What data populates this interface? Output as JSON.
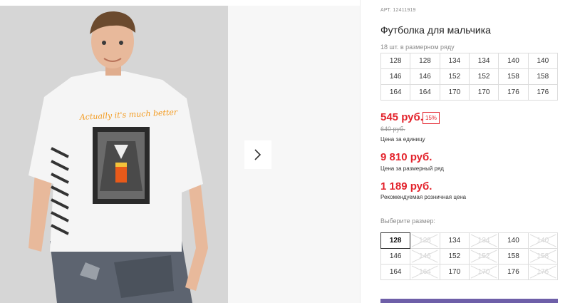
{
  "product": {
    "sku": "АРТ. 12411919",
    "title": "Футболка для мальчика",
    "series_note": "18 шт. в размерном ряду"
  },
  "series_sizes": [
    [
      "128",
      "128",
      "134",
      "134",
      "140",
      "140"
    ],
    [
      "146",
      "146",
      "152",
      "152",
      "158",
      "158"
    ],
    [
      "164",
      "164",
      "170",
      "170",
      "176",
      "176"
    ]
  ],
  "pricing": {
    "unit_price": "545 руб.",
    "discount": "15%",
    "old_price": "640 руб.",
    "unit_caption": "Цена за единицу",
    "series_price": "9 810 руб.",
    "series_caption": "Цена за размерный ряд",
    "retail_price": "1 189 руб.",
    "retail_caption": "Рекомендуемая розничная цена"
  },
  "size_picker": {
    "label": "Выберите размер:",
    "selected": "128",
    "rows": [
      [
        {
          "v": "128",
          "state": "selected"
        },
        {
          "v": "128",
          "state": "unavailable"
        },
        {
          "v": "134",
          "state": "available"
        },
        {
          "v": "134",
          "state": "unavailable"
        },
        {
          "v": "140",
          "state": "available"
        },
        {
          "v": "140",
          "state": "unavailable"
        }
      ],
      [
        {
          "v": "146",
          "state": "available"
        },
        {
          "v": "146",
          "state": "unavailable"
        },
        {
          "v": "152",
          "state": "available"
        },
        {
          "v": "152",
          "state": "unavailable"
        },
        {
          "v": "158",
          "state": "available"
        },
        {
          "v": "158",
          "state": "unavailable"
        }
      ],
      [
        {
          "v": "164",
          "state": "available"
        },
        {
          "v": "164",
          "state": "unavailable"
        },
        {
          "v": "170",
          "state": "available"
        },
        {
          "v": "170",
          "state": "unavailable"
        },
        {
          "v": "176",
          "state": "available"
        },
        {
          "v": "176",
          "state": "unavailable"
        }
      ]
    ]
  },
  "photo": {
    "print_text": "Actually it's much better",
    "colors": {
      "background": "#d6d6d6",
      "shirt": "#f5f5f5",
      "print_orange": "#f39a1e",
      "jeans": "#5d6470",
      "skin": "#e8b99b",
      "hair": "#6b4a2e"
    }
  },
  "icons": {
    "next": "chevron-right-icon",
    "unavailable": "cross-out-icon"
  },
  "colors": {
    "accent": "#e3232c",
    "button": "#6e5fa8"
  }
}
